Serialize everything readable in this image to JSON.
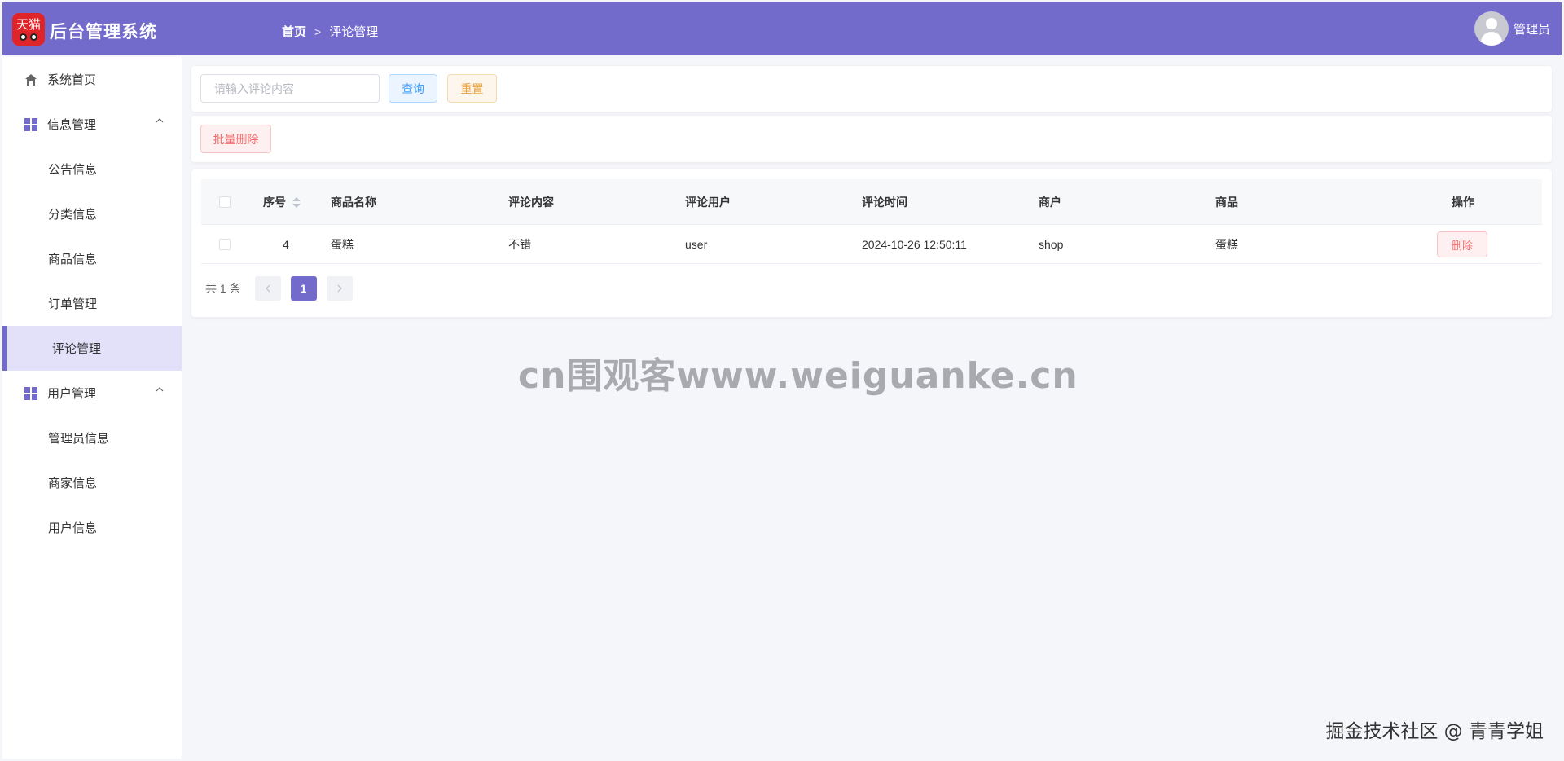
{
  "header": {
    "logo_text": "天猫",
    "app_title": "后台管理系统",
    "breadcrumb": {
      "home": "首页",
      "separator": ">",
      "current": "评论管理"
    },
    "user": {
      "name": "管理员",
      "avatar_icon": "user-avatar-icon"
    },
    "background_color": "#736bcb"
  },
  "sidebar": {
    "home": {
      "label": "系统首页",
      "icon": "home-icon"
    },
    "groups": [
      {
        "label": "信息管理",
        "icon": "grid-icon",
        "items": [
          {
            "label": "公告信息"
          },
          {
            "label": "分类信息"
          },
          {
            "label": "商品信息"
          },
          {
            "label": "订单管理"
          },
          {
            "label": "评论管理",
            "active": true
          }
        ]
      },
      {
        "label": "用户管理",
        "icon": "grid-icon",
        "items": [
          {
            "label": "管理员信息"
          },
          {
            "label": "商家信息"
          },
          {
            "label": "用户信息"
          }
        ]
      }
    ]
  },
  "search": {
    "placeholder": "请输入评论内容",
    "value": "",
    "query_label": "查询",
    "reset_label": "重置"
  },
  "actions": {
    "batch_delete_label": "批量删除"
  },
  "table": {
    "columns": [
      "序号",
      "商品名称",
      "评论内容",
      "评论用户",
      "评论时间",
      "商户",
      "商品",
      "操作"
    ],
    "rows": [
      {
        "id": "4",
        "product_name": "蛋糕",
        "content": "不错",
        "user": "user",
        "time": "2024-10-26 12:50:11",
        "shop": "shop",
        "product": "蛋糕",
        "delete_label": "删除"
      }
    ]
  },
  "pagination": {
    "total_text": "共 1 条",
    "current_page": "1",
    "prev_icon": "chevron-left-icon",
    "next_icon": "chevron-right-icon"
  },
  "watermark": "cn围观客www.weiguanke.cn",
  "footer_watermark": "掘金技术社区 @ 青青学姐"
}
